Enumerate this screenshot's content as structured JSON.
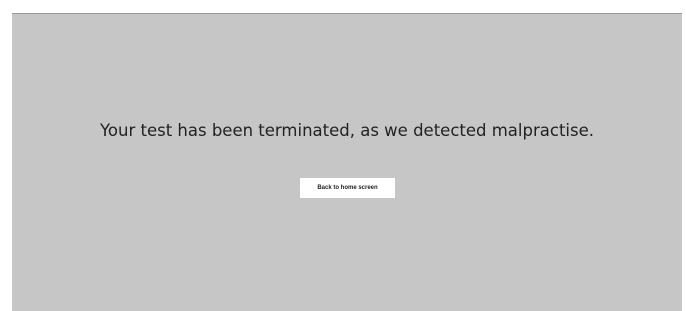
{
  "screen": {
    "message": "Your test has been terminated, as we detected malpractise.",
    "home_button_label": "Back to home screen"
  },
  "colors": {
    "panel_background": "#c6c6c6",
    "page_background": "#ffffff",
    "text": "#222222",
    "button_background": "#ffffff"
  }
}
